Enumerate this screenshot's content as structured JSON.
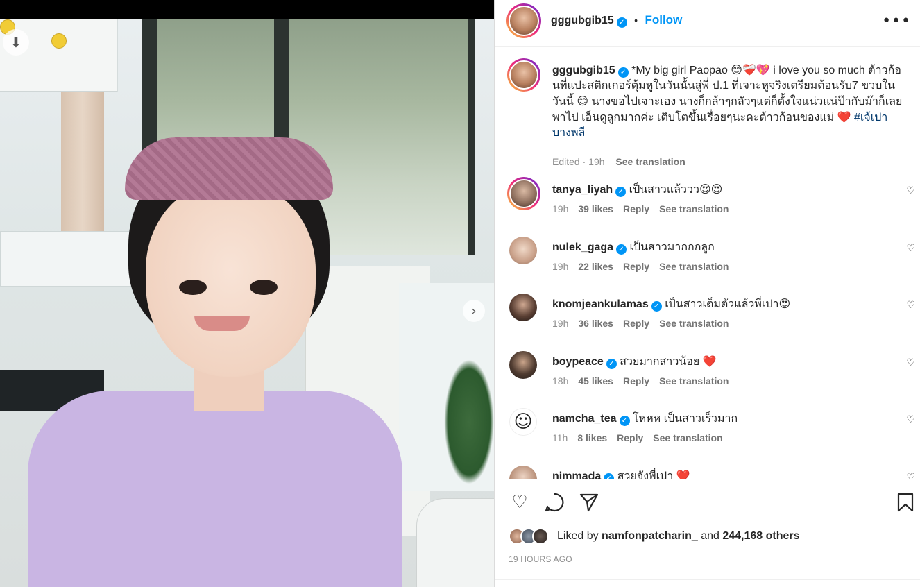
{
  "post": {
    "author": "gggubgib15",
    "follow_label": "Follow",
    "separator": "•",
    "more_icon": "more-horizontal-icon"
  },
  "caption": {
    "username": "gggubgib15",
    "text_part1": "*My big girl Paopao ",
    "text_emojis1": "😊❤️‍🩹💖",
    "text_part2": " i love you so much ต้าวก้อนที่แปะสติกเกอร์ตุ้มหูในวันนั้นสู่พี่ ป.1 ที่เจาะหูจริงเตรียมต้อนรับ7 ขวบในวันนี้ ",
    "text_emoji2": "😊",
    "text_part3": " นางขอไปเจาะเอง นางก็กล้าๆกลัวๆแต่ก็ตั้งใจแน่วแน่ป๊ากับม๊าก็เลยพาไป เอ็นดูลูกมากค่ะ เติบโตขึ้นเรื่อยๆนะคะต้าวก้อนของแม่ ",
    "text_emoji3": "❤️",
    "hashtag": "#เจ้เปาบางพลี",
    "edited": "Edited",
    "time": "19h",
    "see_translation": "See translation"
  },
  "comments": [
    {
      "username": "tanya_liyah",
      "text": "เป็นสาวแล้ววว",
      "emoji": "😍😍",
      "time": "19h",
      "likes": "39 likes",
      "reply": "Reply",
      "translate": "See translation"
    },
    {
      "username": "nulek_gaga",
      "text": "เป็นสาวมากกกลูก",
      "emoji": "",
      "time": "19h",
      "likes": "22 likes",
      "reply": "Reply",
      "translate": "See translation"
    },
    {
      "username": "knomjeankulamas",
      "text": "เป็นสาวเต็มตัวแล้วพี่เปา",
      "emoji": "😍",
      "time": "19h",
      "likes": "36 likes",
      "reply": "Reply",
      "translate": "See translation"
    },
    {
      "username": "boypeace",
      "text": "สวยมากสาวน้อย ",
      "emoji": "❤️",
      "time": "18h",
      "likes": "45 likes",
      "reply": "Reply",
      "translate": "See translation"
    },
    {
      "username": "namcha_tea",
      "text": "โหหห เป็นสาวเร็วมาก",
      "emoji": "",
      "time": "11h",
      "likes": "8 likes",
      "reply": "Reply",
      "translate": "See translation"
    },
    {
      "username": "nimmada",
      "text": "สวยจังพี่เปา ",
      "emoji": "❤️",
      "time": "",
      "likes": "",
      "reply": "",
      "translate": ""
    }
  ],
  "actions": {
    "liked_by_prefix": "Liked by",
    "liked_by_user": "namfonpatcharin_",
    "and": "and",
    "others": "244,168 others",
    "timestamp": "19 HOURS AGO"
  },
  "icons": {
    "like": "heart-icon",
    "comment": "comment-icon",
    "share": "send-icon",
    "save": "bookmark-icon",
    "download": "download-icon",
    "next": "chevron-right-icon",
    "verified": "verified-badge-icon"
  },
  "colors": {
    "accent": "#0095f6",
    "text": "#262626",
    "secondary": "#8e8e8e",
    "hashtag": "#00376b"
  }
}
